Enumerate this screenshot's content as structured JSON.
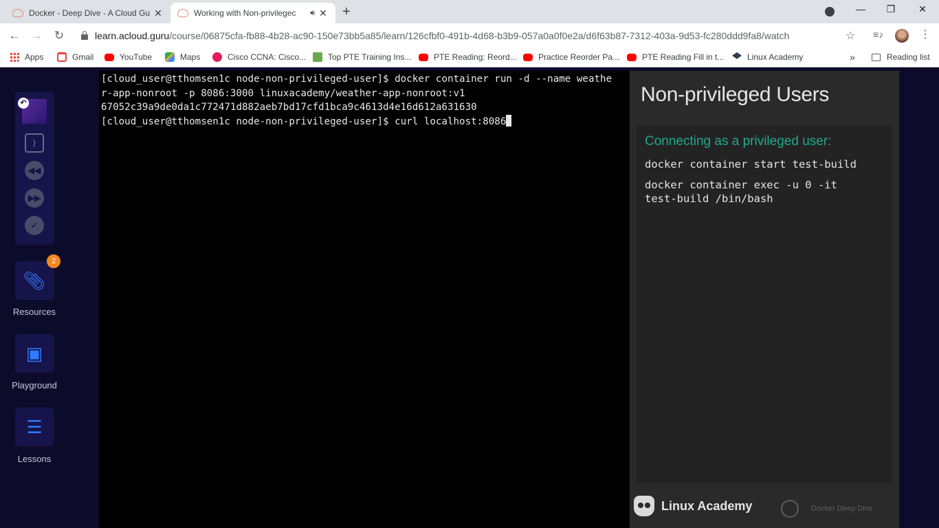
{
  "browser": {
    "tabs": [
      {
        "title": "Docker - Deep Dive - A Cloud Gu",
        "active": false
      },
      {
        "title": "Working with Non-privilegec",
        "active": true
      }
    ],
    "new_tab_symbol": "+",
    "window_controls": {
      "minimize": "—",
      "restore": "❐",
      "close": "✕"
    },
    "url": {
      "host": "learn.acloud.guru",
      "path": "/course/06875cfa-fb88-4b28-ac90-150e73bb5a85/learn/126cfbf0-491b-4d68-b3b9-057a0a0f0e2a/d6f63b87-7312-403a-9d53-fc280ddd9fa8/watch"
    },
    "bookmarks": [
      {
        "label": "Apps",
        "icon": "apps-icon"
      },
      {
        "label": "Gmail",
        "icon": "gmail-icon"
      },
      {
        "label": "YouTube",
        "icon": "youtube-icon"
      },
      {
        "label": "Maps",
        "icon": "maps-icon"
      },
      {
        "label": "Cisco CCNA: Cisco...",
        "icon": "cisco-icon"
      },
      {
        "label": "Top PTE Training Ins...",
        "icon": "pte-icon"
      },
      {
        "label": "PTE Reading: Reord...",
        "icon": "youtube-icon"
      },
      {
        "label": "Practice Reorder Pa...",
        "icon": "youtube-icon"
      },
      {
        "label": "PTE Reading Fill in t...",
        "icon": "youtube-icon"
      },
      {
        "label": "Linux Academy",
        "icon": "linux-academy-icon"
      }
    ],
    "bookmarks_more": "»",
    "reading_list": "Reading list"
  },
  "sidebar": {
    "resources_badge": "2",
    "items": [
      {
        "label": "Resources",
        "icon": "paperclip-icon"
      },
      {
        "label": "Playground",
        "icon": "cubes-icon"
      },
      {
        "label": "Lessons",
        "icon": "list-icon"
      }
    ]
  },
  "terminal": {
    "line1": "[cloud_user@tthomsen1c node-non-privileged-user]$ docker container run -d --name weathe",
    "line2": "r-app-nonroot -p 8086:3000 linuxacademy/weather-app-nonroot:v1",
    "line3": "67052c39a9de0da1c772471d882aeb7bd17cfd1bca9c4613d4e16d612a631630",
    "line4": "[cloud_user@tthomsen1c node-non-privileged-user]$ curl localhost:8086"
  },
  "slide": {
    "title": "Non-privileged Users",
    "subtitle": "Connecting as a privileged user:",
    "code1": "docker container start test-build",
    "code2": "docker container exec -u 0 -it\ntest-build /bin/bash",
    "brand": "Linux Academy",
    "course": "Docker Deep Dive"
  },
  "colors": {
    "accent": "#2f7bff",
    "badge": "#f5871f",
    "slide_subtitle": "#1faa8c",
    "page_bg": "#0d0b2a"
  }
}
